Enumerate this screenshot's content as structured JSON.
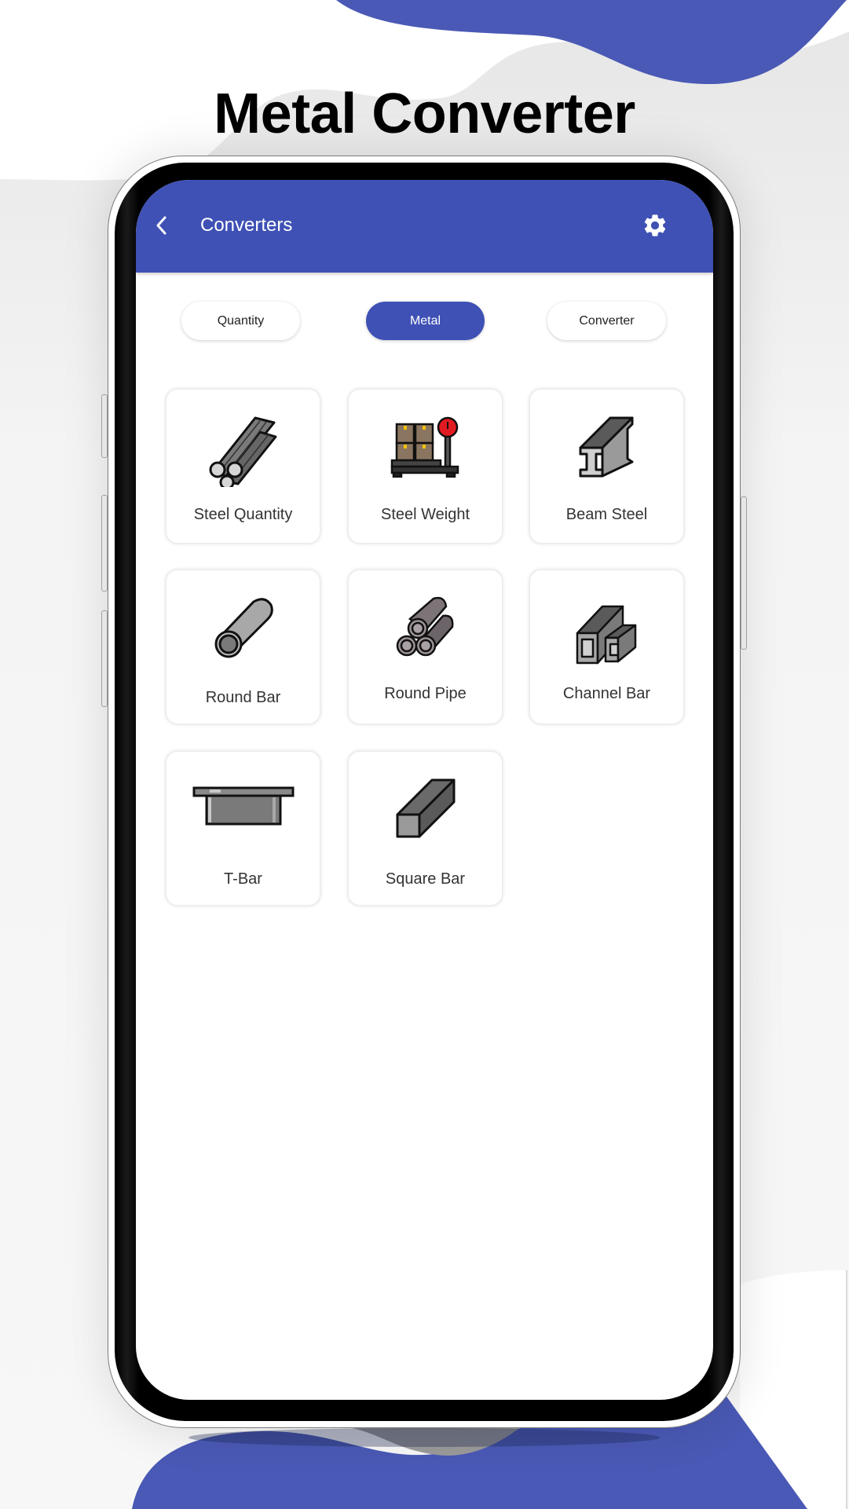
{
  "page_title": "Metal Converter",
  "colors": {
    "accent": "#3f51b5",
    "background_blob": "#4a59b5"
  },
  "appbar": {
    "back_icon": "chevron-left-icon",
    "title": "Converters",
    "settings_icon": "gear-icon"
  },
  "tabs": [
    {
      "label": "Quantity",
      "active": false
    },
    {
      "label": "Metal",
      "active": true
    },
    {
      "label": "Converter",
      "active": false
    }
  ],
  "items": [
    {
      "label": "Steel Quantity",
      "icon": "rebar-bundle-icon"
    },
    {
      "label": "Steel Weight",
      "icon": "weighing-scale-icon"
    },
    {
      "label": "Beam Steel",
      "icon": "i-beam-icon"
    },
    {
      "label": "Round Bar",
      "icon": "round-bar-icon"
    },
    {
      "label": "Round Pipe",
      "icon": "round-pipes-icon"
    },
    {
      "label": "Channel Bar",
      "icon": "channel-bar-icon"
    },
    {
      "label": "T-Bar",
      "icon": "t-bar-icon"
    },
    {
      "label": "Square Bar",
      "icon": "square-bar-icon"
    }
  ]
}
